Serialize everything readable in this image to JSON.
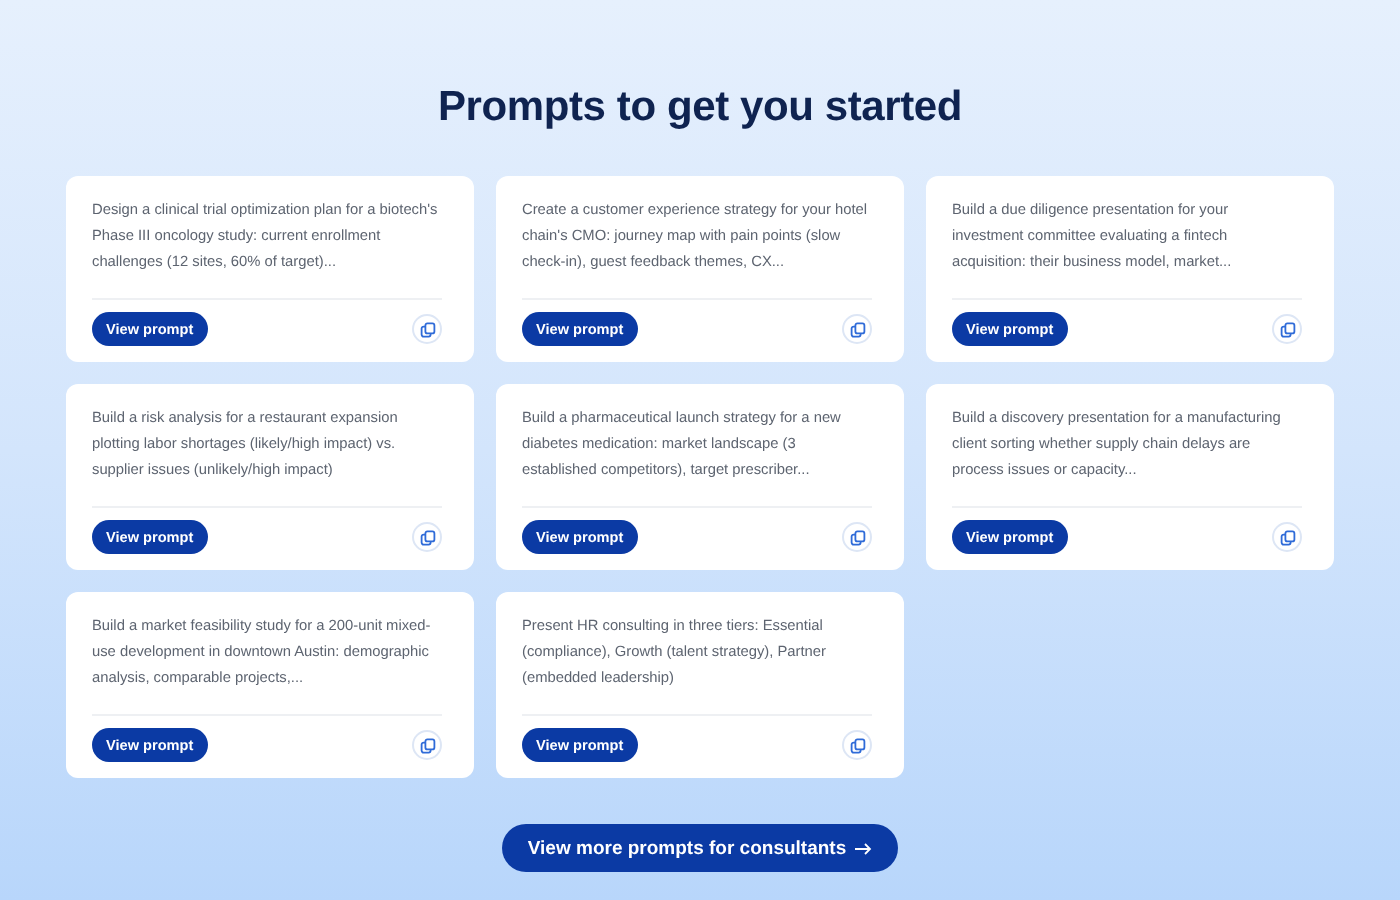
{
  "heading": "Prompts to get you started",
  "cards": [
    {
      "text": "Design a clinical trial optimization plan for a biotech's Phase III oncology study: current enrollment challenges (12 sites, 60% of target)...",
      "button": "View prompt"
    },
    {
      "text": "Create a customer experience strategy for your hotel chain's CMO: journey map with pain points (slow check-in), guest feedback themes, CX...",
      "button": "View prompt"
    },
    {
      "text": "Build a due diligence presentation for your investment committee evaluating a fintech acquisition: their business model, market...",
      "button": "View prompt"
    },
    {
      "text": "Build a risk analysis for a restaurant expansion plotting labor shortages (likely/high impact) vs. supplier issues (unlikely/high impact)",
      "button": "View prompt"
    },
    {
      "text": "Build a pharmaceutical launch strategy for a new diabetes medication: market landscape (3 established competitors), target prescriber...",
      "button": "View prompt"
    },
    {
      "text": "Build a discovery presentation for a manufacturing client sorting whether supply chain delays are process issues or capacity...",
      "button": "View prompt"
    },
    {
      "text": "Build a market feasibility study for a 200-unit mixed-use development in downtown Austin: demographic analysis, comparable projects,...",
      "button": "View prompt"
    },
    {
      "text": "Present HR consulting in three tiers: Essential (compliance), Growth (talent strategy), Partner (embedded leadership)",
      "button": "View prompt"
    }
  ],
  "more_button": "View more prompts for consultants"
}
